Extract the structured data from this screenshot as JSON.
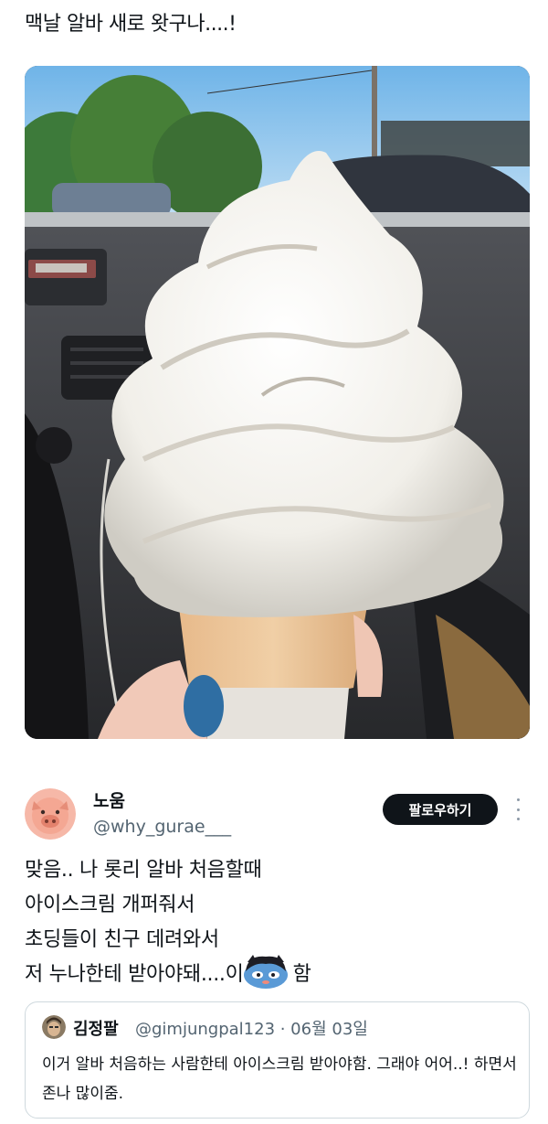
{
  "post": {
    "text": "맥날 알바 새로 왓구나....!"
  },
  "reply": {
    "display_name": "노움",
    "handle": "@why_gurae___",
    "follow_label": "팔로우하기",
    "lines": [
      "맞음.. 나 롯리 알바 처음할때",
      "아이스크림 개퍼줘서",
      "초딩들이 친구 데려와서"
    ],
    "last_line_prefix": "저 누나한테 받아야돼....이",
    "last_line_suffix": "함"
  },
  "quote": {
    "display_name": "김정팔",
    "meta": "@gimjungpal123 · 06월 03일",
    "text": "이거 알바 처음하는 사람한테 아이스크림 받아야함. 그래야 어어..! 하면서 존나 많이줌."
  },
  "icons": {
    "more": "more-vertical-icon",
    "inline_emoji": "cat-emoji-icon"
  },
  "colors": {
    "text": "#0f1419",
    "muted": "#536471",
    "button": "#0f1419"
  }
}
